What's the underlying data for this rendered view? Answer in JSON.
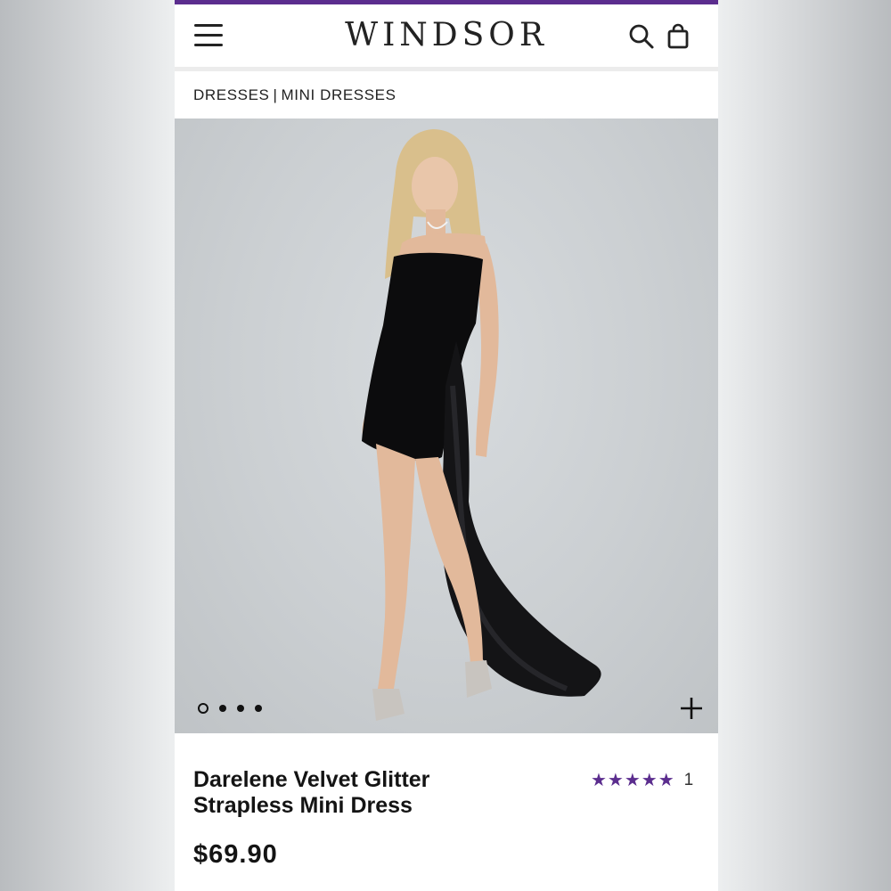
{
  "brand": {
    "logo_text": "WINDSOR",
    "accent_color": "#5b2d8e"
  },
  "header": {
    "menu_icon": "hamburger-menu-icon",
    "search_icon": "search-icon",
    "bag_icon": "shopping-bag-icon"
  },
  "breadcrumb": {
    "items": [
      "DRESSES",
      "MINI DRESSES"
    ],
    "separator": "|"
  },
  "gallery": {
    "image_count": 4,
    "active_index": 0,
    "zoom_icon": "plus-icon"
  },
  "product": {
    "name": "Darelene Velvet Glitter Strapless Mini Dress",
    "rating_stars": "★★★★★",
    "rating_value": 5,
    "review_count": "1",
    "price": "$69.90"
  }
}
